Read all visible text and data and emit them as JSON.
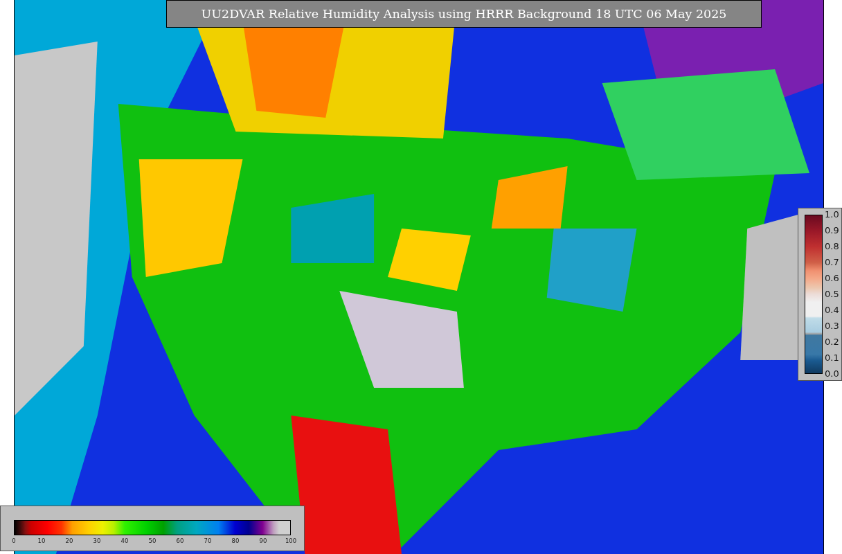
{
  "title": "UU2DVAR Relative Humidity Analysis using HRRR Background 18 UTC 06 May 2025",
  "humidity_legend": {
    "ticks": [
      "0",
      "10",
      "20",
      "30",
      "40",
      "50",
      "60",
      "70",
      "80",
      "90",
      "100"
    ]
  },
  "observation_legend": {
    "ticks": [
      "1.0",
      "0.9",
      "0.8",
      "0.7",
      "0.6",
      "0.5",
      "0.4",
      "0.3",
      "0.2",
      "0.1",
      "0.0"
    ]
  }
}
